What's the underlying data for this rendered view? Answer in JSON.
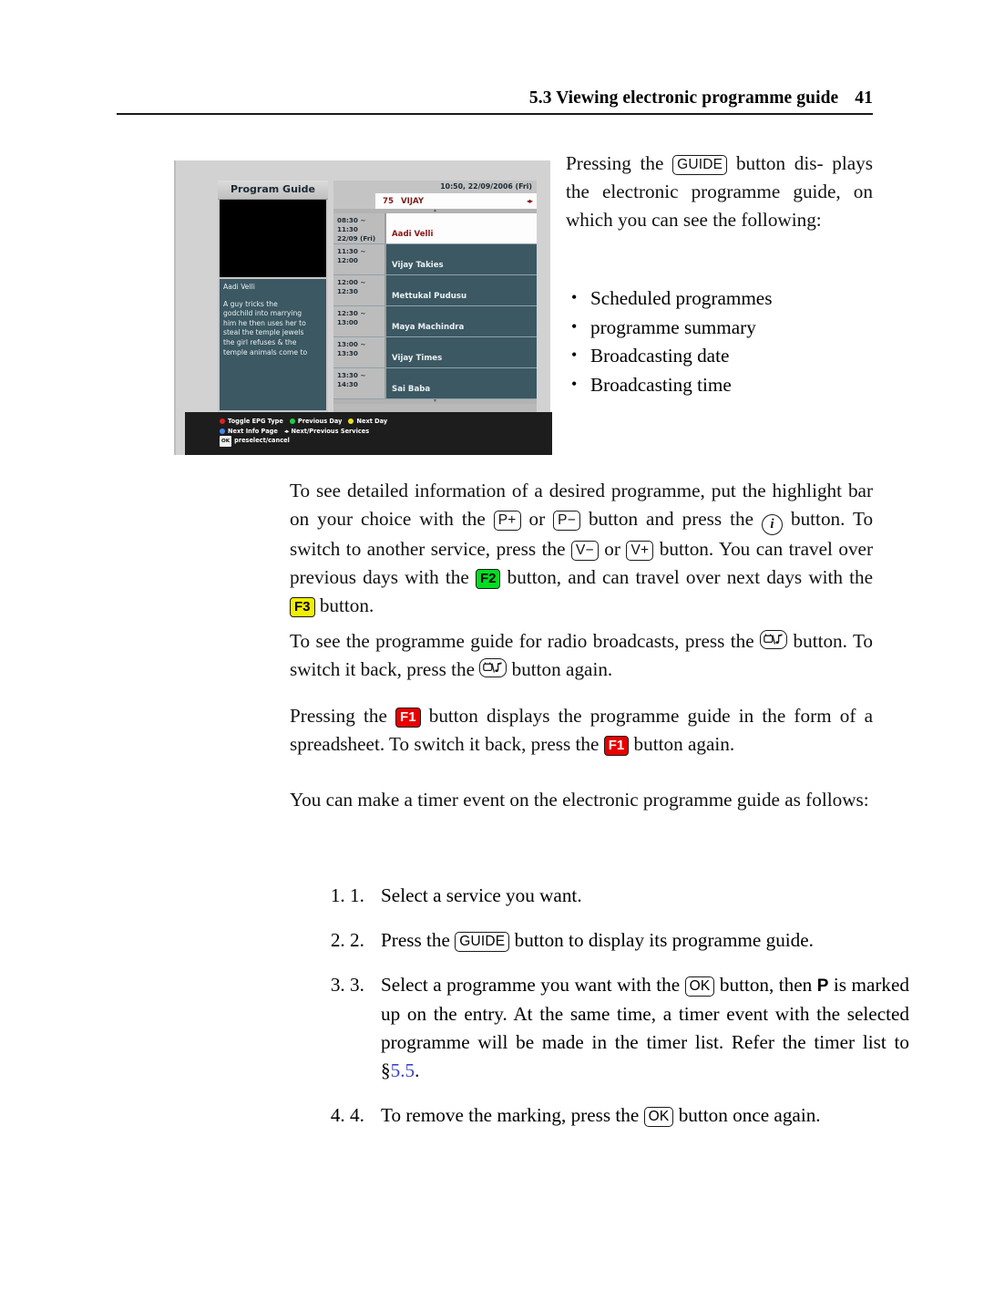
{
  "header": {
    "title": "5.3 Viewing electronic programme guide",
    "page_number": "41"
  },
  "figure": {
    "name": "epg-screenshot",
    "left_panel": {
      "title": "Program Guide",
      "programme_title": "Aadi Velli",
      "summary": "A guy tricks the\ngodchild into marrying\nhim he then uses her to\nsteal the temple jewels\nthe girl refuses & the\ntemple animals come to"
    },
    "right_panel": {
      "clock": "10:50, 22/09/2006 (Fri)",
      "channel_number": "75",
      "channel_name": "VIJAY",
      "channel_arrows": "◂▸",
      "scroll_up": "▲",
      "scroll_down": "▼",
      "rows": [
        {
          "time": "08:30 ~ 11:30",
          "date": "22/09 (Fri)",
          "title": "Aadi Velli",
          "current": true
        },
        {
          "time": "11:30 ~ 12:00",
          "date": "",
          "title": "Vijay Takies",
          "current": false
        },
        {
          "time": "12:00 ~ 12:30",
          "date": "",
          "title": "Mettukal Pudusu",
          "current": false
        },
        {
          "time": "12:30 ~ 13:00",
          "date": "",
          "title": "Maya Machindra",
          "current": false
        },
        {
          "time": "13:00 ~ 13:30",
          "date": "",
          "title": "Vijay Times",
          "current": false
        },
        {
          "time": "13:30 ~ 14:30",
          "date": "",
          "title": "Sai Baba",
          "current": false
        }
      ]
    },
    "legend": {
      "red_label": "Toggle EPG Type",
      "green_label": "Previous Day",
      "yellow_label": "Next Day",
      "blue_label": "Next Info Page",
      "arrows_glyph": "◂▸",
      "arrows_label": "Next/Previous Services",
      "ok_chip": "OK",
      "ok_label": "preselect/cancel"
    },
    "colors": {
      "frame": "#d2d2d2",
      "panel_teal": "#3c5862",
      "highlight_white": "#fdfdfd",
      "highlight_text_red": "#8a1414",
      "legend_bar": "#1d1d1d"
    }
  },
  "intro": {
    "line1_a": "Pressing the",
    "key_guide": "GUIDE",
    "line1_b": "button dis-",
    "line2": "plays the electronic programme",
    "line3": "guide, on which you can see the",
    "line4": "following:",
    "bullets": [
      "Scheduled programmes",
      "programme summary",
      "Broadcasting date",
      "Broadcasting time"
    ]
  },
  "para_detail": {
    "t1": "To see detailed information of a desired programme, put the highlight bar on your choice with the",
    "key_pplus": "P+",
    "t2": "or",
    "key_pminus": "P−",
    "t3": "button and press the",
    "key_info": "i",
    "t4": "button.  To switch to another service, press the",
    "key_vminus": "V−",
    "t5": "or",
    "key_vplus": "V+",
    "t6": "button. You can travel over previous days with the",
    "key_f2": "F2",
    "t7": "button, and can travel over next days with the",
    "key_f3": "F3",
    "t8": "button."
  },
  "para_radio": {
    "t1": "To see the programme guide for radio broadcasts, press the",
    "key_tvradio": "tv-radio-icon",
    "t2": "button. To switch it back, press the",
    "t3": "button again."
  },
  "para_spreadsheet": {
    "t1": "Pressing the",
    "key_f1": "F1",
    "t2": "button displays the programme guide in the form of a spreadsheet. To switch it back, press the",
    "t3": "button again."
  },
  "para_timer": {
    "t1": "You can make a timer event on the electronic programme guide as follows:"
  },
  "steps": [
    {
      "num": "1.",
      "t1": "Select a service you want."
    },
    {
      "num": "2.",
      "t1": "Press the",
      "key": "GUIDE",
      "t2": "button to display its programme guide."
    },
    {
      "num": "3.",
      "t1": "Select a programme you want with the",
      "key": "OK",
      "t2": "button, then",
      "marker": "P",
      "t3": "is marked up on the entry.  At the same time, a timer event with the selected programme will be made in the timer list. Refer the timer list to §",
      "xref": "5.5",
      "t4": "."
    },
    {
      "num": "4.",
      "t1": "To remove the marking, press the",
      "key": "OK",
      "t2": "button once again."
    }
  ]
}
